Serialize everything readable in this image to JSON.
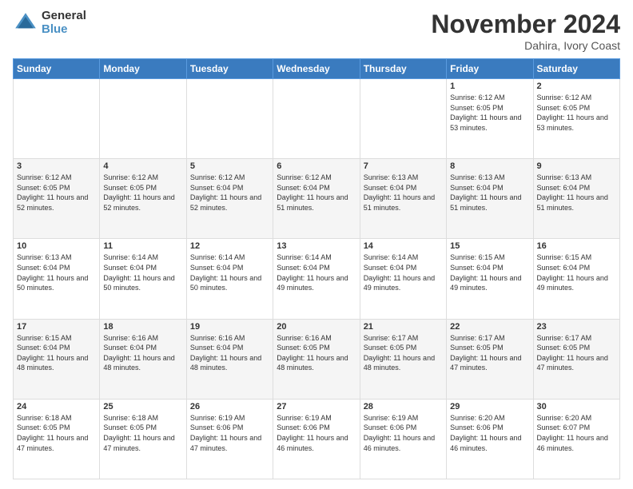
{
  "logo": {
    "general": "General",
    "blue": "Blue"
  },
  "title": "November 2024",
  "location": "Dahira, Ivory Coast",
  "days_of_week": [
    "Sunday",
    "Monday",
    "Tuesday",
    "Wednesday",
    "Thursday",
    "Friday",
    "Saturday"
  ],
  "weeks": [
    [
      {
        "day": "",
        "info": ""
      },
      {
        "day": "",
        "info": ""
      },
      {
        "day": "",
        "info": ""
      },
      {
        "day": "",
        "info": ""
      },
      {
        "day": "",
        "info": ""
      },
      {
        "day": "1",
        "info": "Sunrise: 6:12 AM\nSunset: 6:05 PM\nDaylight: 11 hours\nand 53 minutes."
      },
      {
        "day": "2",
        "info": "Sunrise: 6:12 AM\nSunset: 6:05 PM\nDaylight: 11 hours\nand 53 minutes."
      }
    ],
    [
      {
        "day": "3",
        "info": "Sunrise: 6:12 AM\nSunset: 6:05 PM\nDaylight: 11 hours\nand 52 minutes."
      },
      {
        "day": "4",
        "info": "Sunrise: 6:12 AM\nSunset: 6:05 PM\nDaylight: 11 hours\nand 52 minutes."
      },
      {
        "day": "5",
        "info": "Sunrise: 6:12 AM\nSunset: 6:04 PM\nDaylight: 11 hours\nand 52 minutes."
      },
      {
        "day": "6",
        "info": "Sunrise: 6:12 AM\nSunset: 6:04 PM\nDaylight: 11 hours\nand 51 minutes."
      },
      {
        "day": "7",
        "info": "Sunrise: 6:13 AM\nSunset: 6:04 PM\nDaylight: 11 hours\nand 51 minutes."
      },
      {
        "day": "8",
        "info": "Sunrise: 6:13 AM\nSunset: 6:04 PM\nDaylight: 11 hours\nand 51 minutes."
      },
      {
        "day": "9",
        "info": "Sunrise: 6:13 AM\nSunset: 6:04 PM\nDaylight: 11 hours\nand 51 minutes."
      }
    ],
    [
      {
        "day": "10",
        "info": "Sunrise: 6:13 AM\nSunset: 6:04 PM\nDaylight: 11 hours\nand 50 minutes."
      },
      {
        "day": "11",
        "info": "Sunrise: 6:14 AM\nSunset: 6:04 PM\nDaylight: 11 hours\nand 50 minutes."
      },
      {
        "day": "12",
        "info": "Sunrise: 6:14 AM\nSunset: 6:04 PM\nDaylight: 11 hours\nand 50 minutes."
      },
      {
        "day": "13",
        "info": "Sunrise: 6:14 AM\nSunset: 6:04 PM\nDaylight: 11 hours\nand 49 minutes."
      },
      {
        "day": "14",
        "info": "Sunrise: 6:14 AM\nSunset: 6:04 PM\nDaylight: 11 hours\nand 49 minutes."
      },
      {
        "day": "15",
        "info": "Sunrise: 6:15 AM\nSunset: 6:04 PM\nDaylight: 11 hours\nand 49 minutes."
      },
      {
        "day": "16",
        "info": "Sunrise: 6:15 AM\nSunset: 6:04 PM\nDaylight: 11 hours\nand 49 minutes."
      }
    ],
    [
      {
        "day": "17",
        "info": "Sunrise: 6:15 AM\nSunset: 6:04 PM\nDaylight: 11 hours\nand 48 minutes."
      },
      {
        "day": "18",
        "info": "Sunrise: 6:16 AM\nSunset: 6:04 PM\nDaylight: 11 hours\nand 48 minutes."
      },
      {
        "day": "19",
        "info": "Sunrise: 6:16 AM\nSunset: 6:04 PM\nDaylight: 11 hours\nand 48 minutes."
      },
      {
        "day": "20",
        "info": "Sunrise: 6:16 AM\nSunset: 6:05 PM\nDaylight: 11 hours\nand 48 minutes."
      },
      {
        "day": "21",
        "info": "Sunrise: 6:17 AM\nSunset: 6:05 PM\nDaylight: 11 hours\nand 48 minutes."
      },
      {
        "day": "22",
        "info": "Sunrise: 6:17 AM\nSunset: 6:05 PM\nDaylight: 11 hours\nand 47 minutes."
      },
      {
        "day": "23",
        "info": "Sunrise: 6:17 AM\nSunset: 6:05 PM\nDaylight: 11 hours\nand 47 minutes."
      }
    ],
    [
      {
        "day": "24",
        "info": "Sunrise: 6:18 AM\nSunset: 6:05 PM\nDaylight: 11 hours\nand 47 minutes."
      },
      {
        "day": "25",
        "info": "Sunrise: 6:18 AM\nSunset: 6:05 PM\nDaylight: 11 hours\nand 47 minutes."
      },
      {
        "day": "26",
        "info": "Sunrise: 6:19 AM\nSunset: 6:06 PM\nDaylight: 11 hours\nand 47 minutes."
      },
      {
        "day": "27",
        "info": "Sunrise: 6:19 AM\nSunset: 6:06 PM\nDaylight: 11 hours\nand 46 minutes."
      },
      {
        "day": "28",
        "info": "Sunrise: 6:19 AM\nSunset: 6:06 PM\nDaylight: 11 hours\nand 46 minutes."
      },
      {
        "day": "29",
        "info": "Sunrise: 6:20 AM\nSunset: 6:06 PM\nDaylight: 11 hours\nand 46 minutes."
      },
      {
        "day": "30",
        "info": "Sunrise: 6:20 AM\nSunset: 6:07 PM\nDaylight: 11 hours\nand 46 minutes."
      }
    ]
  ]
}
